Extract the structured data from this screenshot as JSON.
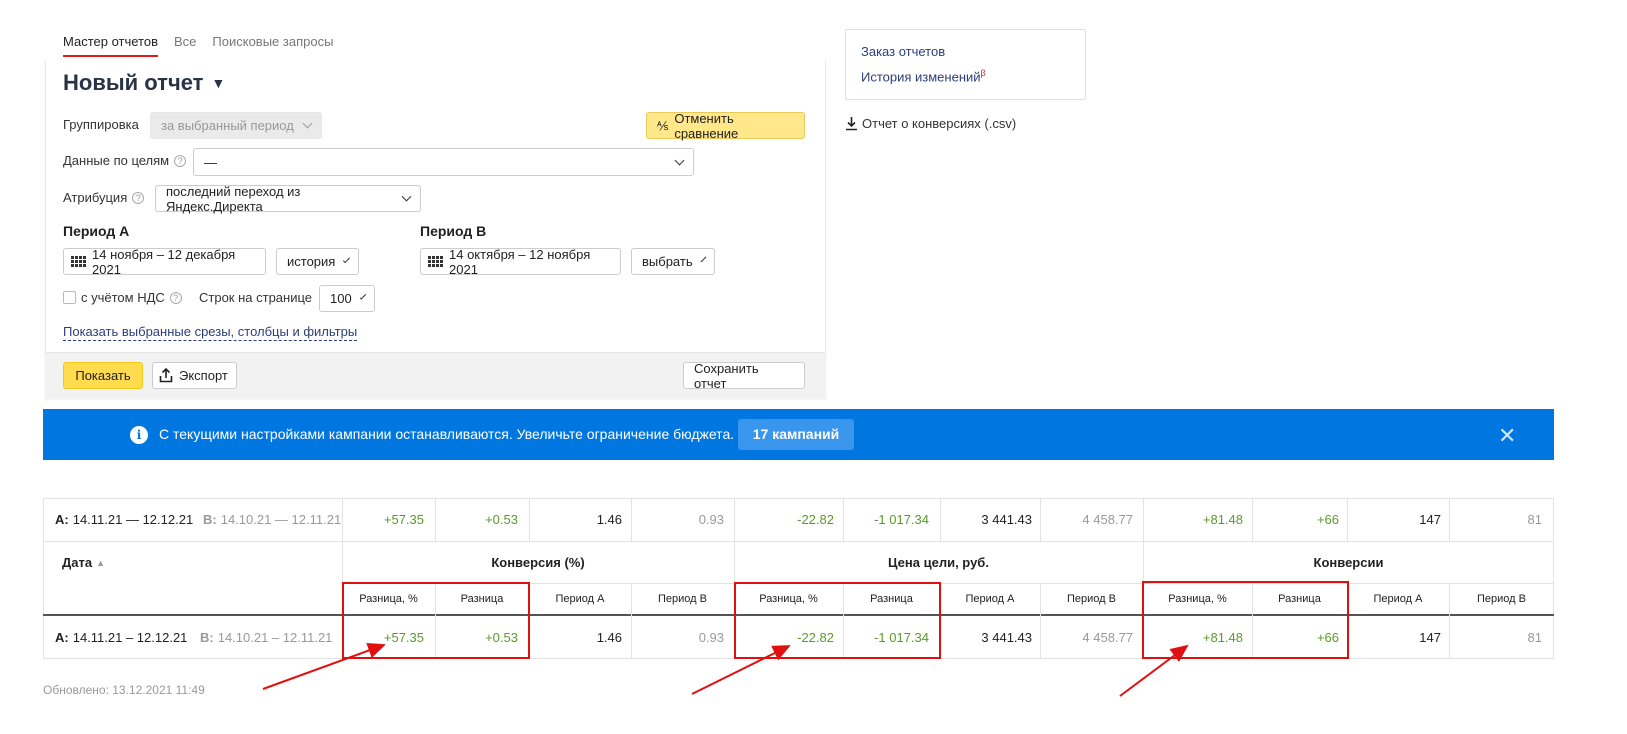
{
  "tabs": [
    "Мастер отчетов",
    "Все",
    "Поисковые запросы"
  ],
  "title": "Новый отчет",
  "form": {
    "grouping_label": "Группировка",
    "grouping_value": "за выбранный период",
    "cancel_compare": "Отменить сравнение",
    "goals_label": "Данные по целям",
    "goals_value": "—",
    "attribution_label": "Атрибуция",
    "attribution_value": "последний переход из Яндекс.Директа",
    "period_a_label": "Период А",
    "period_a_value": "14 ноября – 12 декабря 2021",
    "period_a_preset": "история",
    "period_b_label": "Период В",
    "period_b_value": "14 октября – 12 ноября 2021",
    "period_b_preset": "выбрать",
    "vat_label": "с учётом НДС",
    "rows_label": "Строк на странице",
    "rows_value": "100",
    "show_slices_link": "Показать выбранные срезы, столбцы и фильтры",
    "show_button": "Показать",
    "export_button": "Экспорт",
    "save_button": "Сохранить отчет"
  },
  "side": {
    "order_reports": "Заказ отчетов",
    "history": "История изменений",
    "history_badge": "β",
    "csv_link": "Отчет о конверсиях (.csv)"
  },
  "banner": {
    "text": "С текущими настройками кампании останавливаются. Увеличьте ограничение бюджета.",
    "button": "17 кампаний"
  },
  "table": {
    "summary": {
      "a_prefix": "А:",
      "a_range": "14.11.21 — 12.12.21",
      "b_prefix": "В:",
      "b_range": "14.10.21 — 12.11.21"
    },
    "date_header": "Дата",
    "groups": [
      "Конверсия (%)",
      "Цена цели, руб.",
      "Конверсии"
    ],
    "subheaders": [
      "Разница, %",
      "Разница",
      "Период А",
      "Период В"
    ],
    "row": {
      "a_prefix": "А:",
      "a_range": "14.11.21 – 12.12.21",
      "b_prefix": "В:",
      "b_range": "14.10.21 – 12.11.21"
    },
    "values": [
      [
        "+57.35",
        "+0.53",
        "1.46",
        "0.93"
      ],
      [
        "-22.82",
        "-1 017.34",
        "3 441.43",
        "4 458.77"
      ],
      [
        "+81.48",
        "+66",
        "147",
        "81"
      ]
    ]
  },
  "updated": "Обновлено: 13.12.2021 11:49",
  "colors": {
    "accent_red": "#e21b1b",
    "banner_blue": "#0077e0",
    "yellow": "#ffdb4d",
    "positive_green": "#5a9a2a"
  }
}
